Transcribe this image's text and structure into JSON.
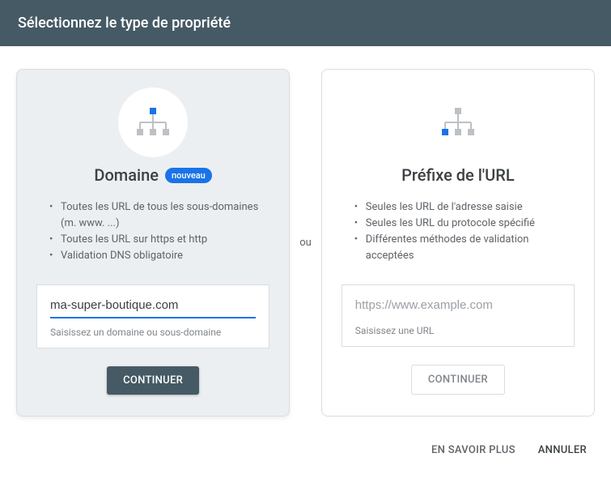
{
  "header": {
    "title": "Sélectionnez le type de propriété"
  },
  "separator": "ou",
  "domain_card": {
    "title": "Domaine",
    "badge": "nouveau",
    "bullets": [
      "Toutes les URL de tous les sous-domaines (m. www. ...)",
      "Toutes les URL sur https et http",
      "Validation DNS obligatoire"
    ],
    "input_value": "ma-super-boutique.com",
    "helper": "Saisissez un domaine ou sous-domaine",
    "button": "CONTINUER"
  },
  "url_card": {
    "title": "Préfixe de l'URL",
    "bullets": [
      "Seules les URL de l'adresse saisie",
      "Seules les URL du protocole spécifié",
      "Différentes méthodes de validation acceptées"
    ],
    "input_placeholder": "https://www.example.com",
    "helper": "Saisissez une URL",
    "button": "CONTINUER"
  },
  "footer": {
    "learn_more": "EN SAVOIR PLUS",
    "cancel": "ANNULER"
  }
}
